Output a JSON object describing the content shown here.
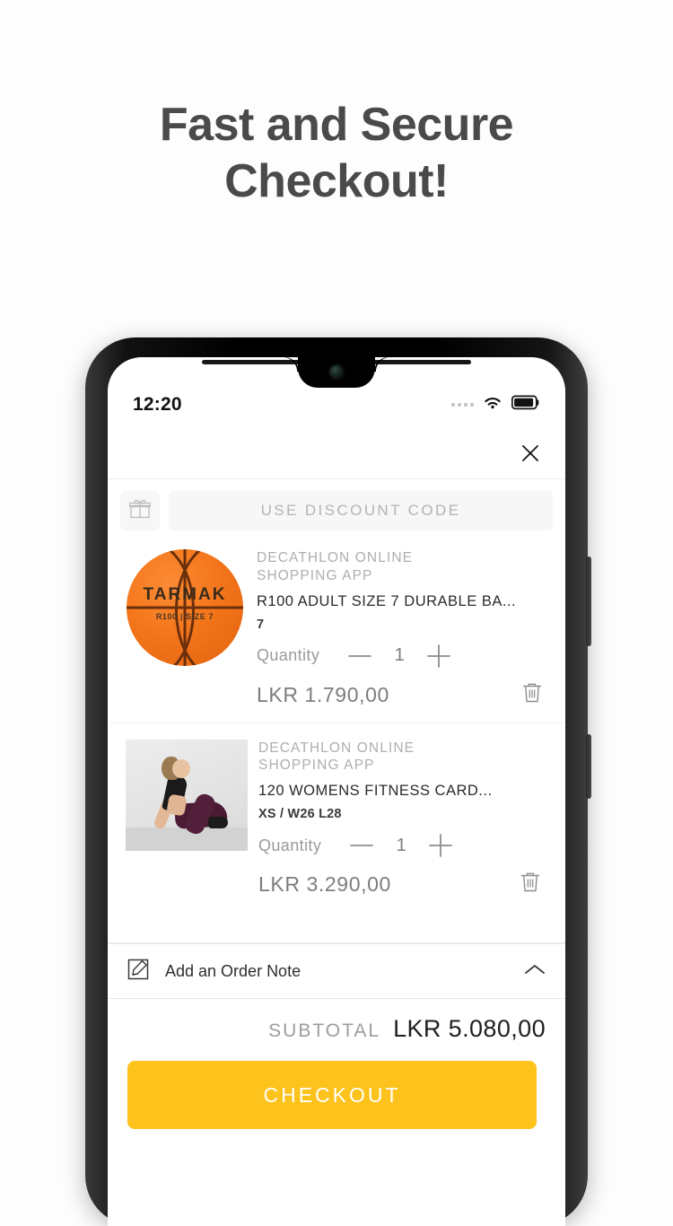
{
  "promo": {
    "line1": "Fast and Secure",
    "line2": "Checkout!"
  },
  "status_bar": {
    "time": "12:20",
    "wifi_icon": "wifi-icon",
    "battery_icon": "battery-icon",
    "signal_icon": "signal-dots-icon"
  },
  "header": {
    "close_icon": "close-icon"
  },
  "discount": {
    "gift_icon": "gift-icon",
    "placeholder": "USE DISCOUNT CODE"
  },
  "cart": {
    "items": [
      {
        "vendor": "DECATHLON ONLINE\nSHOPPING APP",
        "title": "R100 ADULT SIZE 7 DURABLE BA...",
        "variant": "7",
        "quantity_label": "Quantity",
        "quantity": "1",
        "minus_icon": "minus-icon",
        "plus_icon": "plus-icon",
        "price": "LKR 1.790,00",
        "delete_icon": "trash-icon",
        "image": "basketball-tarmak",
        "image_brand": "TARMAK",
        "image_model": "R100 | SIZE 7"
      },
      {
        "vendor": "DECATHLON ONLINE\nSHOPPING APP",
        "title": "120 WOMENS FITNESS CARD...",
        "variant": "XS / W26 L28",
        "quantity_label": "Quantity",
        "quantity": "1",
        "minus_icon": "minus-icon",
        "plus_icon": "plus-icon",
        "price": "LKR 3.290,00",
        "delete_icon": "trash-icon",
        "image": "womens-fitness-leggings-model"
      }
    ]
  },
  "order_note": {
    "icon": "edit-note-icon",
    "label": "Add an Order Note",
    "chevron_icon": "chevron-up-icon"
  },
  "summary": {
    "subtotal_label": "SUBTOTAL",
    "subtotal_value": "LKR 5.080,00",
    "checkout_label": "CHECKOUT"
  },
  "colors": {
    "accent_yellow": "#fdc21c",
    "page_background": "#fdfdfd",
    "text_muted": "#9a9a9a"
  }
}
